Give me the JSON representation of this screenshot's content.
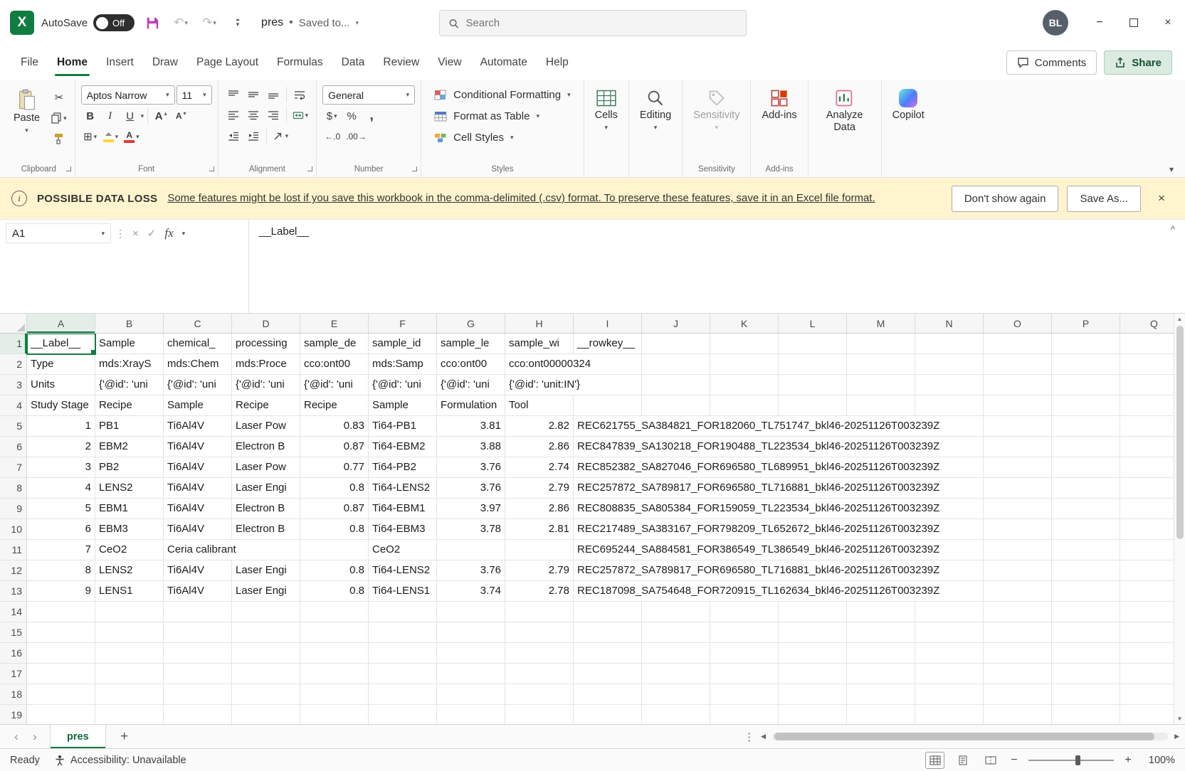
{
  "colors": {
    "accent_green": "#107C41",
    "warning_bg": "#FFF4CE",
    "save_icon_magenta": "#BE3FB4",
    "sheet_tab_green": "#0E6B3C"
  },
  "icons": {
    "logo_letter": "X",
    "chevron_down": "▾",
    "collapse_up": "^",
    "close": "×",
    "check": "✓",
    "dots_vertical": "⋮",
    "undo": "↶",
    "redo": "↷",
    "cut": "✂",
    "bullet": "•",
    "plus": "+",
    "minus": "−",
    "info": "i",
    "nav_left": "‹",
    "nav_right": "›",
    "scroll_left": "◀",
    "scroll_right": "▶",
    "scroll_up": "▲",
    "scroll_down": "▼",
    "tri_up": "▴",
    "tri_down": "▾",
    "dollar": "$",
    "percent": "%",
    "comma": ",",
    "inc_decimal": "←.0",
    "dec_decimal": ".00→",
    "borders_grid": "⊞",
    "letter_a": "A"
  },
  "titlebar": {
    "autosave_label": "AutoSave",
    "autosave_state": "Off",
    "doc_title": "pres",
    "doc_status": "Saved to...",
    "search_placeholder": "Search",
    "avatar_initials": "BL"
  },
  "ribbon": {
    "tabs": [
      "File",
      "Home",
      "Insert",
      "Draw",
      "Page Layout",
      "Formulas",
      "Data",
      "Review",
      "View",
      "Automate",
      "Help"
    ],
    "active_tab": "Home",
    "comments_label": "Comments",
    "share_label": "Share",
    "paste_label": "Paste",
    "font_name": "Aptos Narrow",
    "font_size": "11",
    "bold": "B",
    "italic": "I",
    "underline": "U",
    "number_format": "General",
    "conditional_formatting_label": "Conditional Formatting",
    "format_as_table_label": "Format as Table",
    "cell_styles_label": "Cell Styles",
    "cells_label": "Cells",
    "editing_label": "Editing",
    "sensitivity_label": "Sensitivity",
    "addins_label": "Add-ins",
    "analyze_data_label": "Analyze Data",
    "copilot_label": "Copilot",
    "group_labels": {
      "clipboard": "Clipboard",
      "font": "Font",
      "alignment": "Alignment",
      "number": "Number",
      "styles": "Styles",
      "sensitivity": "Sensitivity",
      "addins": "Add-ins"
    }
  },
  "warning": {
    "title": "POSSIBLE DATA LOSS",
    "message": "Some features might be lost if you save this workbook in the comma-delimited (.csv) format. To preserve these features, save it in an Excel file format.",
    "dont_show_label": "Don't show again",
    "save_as_label": "Save As..."
  },
  "formula_bar": {
    "cell_ref": "A1",
    "fx_label": "fx",
    "value": "__Label__"
  },
  "grid": {
    "columns": [
      "A",
      "B",
      "C",
      "D",
      "E",
      "F",
      "G",
      "H",
      "I",
      "J",
      "K",
      "L",
      "M",
      "N",
      "O",
      "P",
      "Q"
    ],
    "row_count": 19,
    "selected": "A1",
    "rows": [
      [
        "__Label__",
        "Sample",
        "chemical_",
        "processing",
        "sample_de",
        "sample_id",
        "sample_le",
        "sample_wi",
        "__rowkey__"
      ],
      [
        "Type",
        "mds:XrayS",
        "mds:Chem",
        "mds:Proce",
        "cco:ont00",
        "mds:Samp",
        "cco:ont00",
        "cco:ont00000324",
        ""
      ],
      [
        "Units",
        "{'@id': 'uni",
        "{'@id': 'uni",
        "{'@id': 'uni",
        "{'@id': 'uni",
        "{'@id': 'uni",
        "{'@id': 'uni",
        "{'@id': 'unit:IN'}",
        ""
      ],
      [
        "Study Stage",
        "Recipe",
        "Sample",
        "Recipe",
        "Recipe",
        "Sample",
        "Formulation",
        "Tool",
        ""
      ],
      [
        "1",
        "PB1",
        "Ti6Al4V",
        "Laser Pow",
        "0.83",
        "Ti64-PB1",
        "3.81",
        "2.82",
        "REC621755_SA384821_FOR182060_TL751747_bkl46-20251126T003239Z"
      ],
      [
        "2",
        "EBM2",
        "Ti6Al4V",
        "Electron B",
        "0.87",
        "Ti64-EBM2",
        "3.88",
        "2.86",
        "REC847839_SA130218_FOR190488_TL223534_bkl46-20251126T003239Z"
      ],
      [
        "3",
        "PB2",
        "Ti6Al4V",
        "Laser Pow",
        "0.77",
        "Ti64-PB2",
        "3.76",
        "2.74",
        "REC852382_SA827046_FOR696580_TL689951_bkl46-20251126T003239Z"
      ],
      [
        "4",
        "LENS2",
        "Ti6Al4V",
        "Laser Engi",
        "0.8",
        "Ti64-LENS2",
        "3.76",
        "2.79",
        "REC257872_SA789817_FOR696580_TL716881_bkl46-20251126T003239Z"
      ],
      [
        "5",
        "EBM1",
        "Ti6Al4V",
        "Electron B",
        "0.87",
        "Ti64-EBM1",
        "3.97",
        "2.86",
        "REC808835_SA805384_FOR159059_TL223534_bkl46-20251126T003239Z"
      ],
      [
        "6",
        "EBM3",
        "Ti6Al4V",
        "Electron B",
        "0.8",
        "Ti64-EBM3",
        "3.78",
        "2.81",
        "REC217489_SA383167_FOR798209_TL652672_bkl46-20251126T003239Z"
      ],
      [
        "7",
        "CeO2",
        "Ceria calibrant",
        "",
        "",
        "CeO2",
        "",
        "",
        "REC695244_SA884581_FOR386549_TL386549_bkl46-20251126T003239Z"
      ],
      [
        "8",
        "LENS2",
        "Ti6Al4V",
        "Laser Engi",
        "0.8",
        "Ti64-LENS2",
        "3.76",
        "2.79",
        "REC257872_SA789817_FOR696580_TL716881_bkl46-20251126T003239Z"
      ],
      [
        "9",
        "LENS1",
        "Ti6Al4V",
        "Laser Engi",
        "0.8",
        "Ti64-LENS1",
        "3.74",
        "2.78",
        "REC187098_SA754648_FOR720915_TL162634_bkl46-20251126T003239Z"
      ]
    ]
  },
  "sheet_bar": {
    "active_tab": "pres"
  },
  "status_bar": {
    "ready_label": "Ready",
    "accessibility_label": "Accessibility: Unavailable",
    "zoom_level": "100%"
  }
}
